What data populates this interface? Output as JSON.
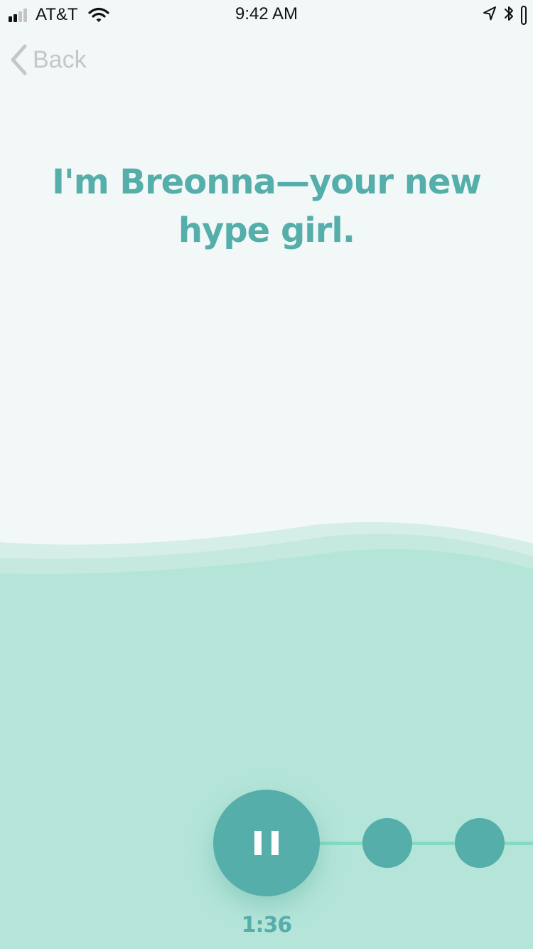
{
  "status_bar": {
    "carrier": "AT&T",
    "time": "9:42 AM",
    "signal_bars_filled": 2,
    "signal_bars_total": 4,
    "icons": [
      "signal-icon",
      "wifi-icon",
      "location-arrow-icon",
      "bluetooth-icon",
      "battery-icon"
    ],
    "battery_level": 1.0
  },
  "nav": {
    "back_label": "Back",
    "back_icon": "chevron-left-icon"
  },
  "main": {
    "headline": "I'm Breonna—your new hype girl."
  },
  "player": {
    "pause_icon": "pause-icon",
    "elapsed": "1:36",
    "steps_visible": 2
  },
  "colors": {
    "background": "#f2f8f8",
    "accent": "#55aeaa",
    "wave_light": "#d6eee8",
    "wave_mid": "#c6e9df",
    "wave_main": "#b5e5d9",
    "track_line": "#82dcc2",
    "back_label": "#c3c7c8"
  }
}
